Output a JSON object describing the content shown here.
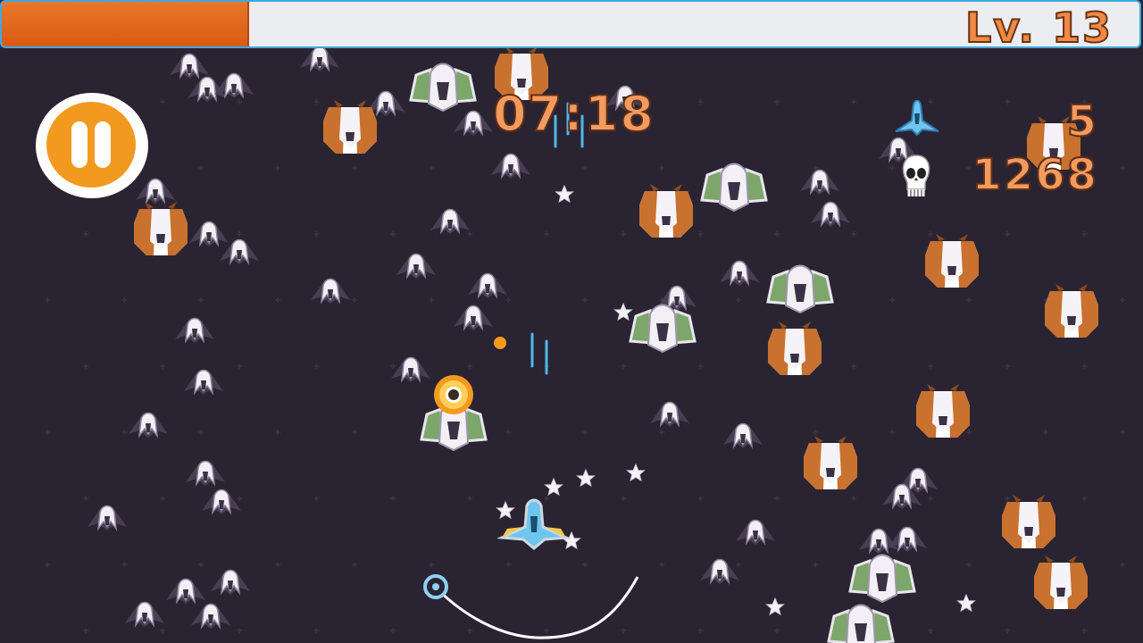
{
  "hud": {
    "level_text": "Lv. 13",
    "xp_progress": 0.216,
    "timer": "07:18",
    "kills": "5",
    "score": "1268",
    "icons": {
      "player_icon": "mini-ship-icon",
      "kills_icon": "skull-icon",
      "pause": "pause-icon"
    }
  },
  "colors": {
    "background": "#2a2432",
    "xp_fill": "#e8782a",
    "xp_border": "#3fa9e0",
    "hud_text": "#f39a5f",
    "pause": "#f29a1f"
  }
}
